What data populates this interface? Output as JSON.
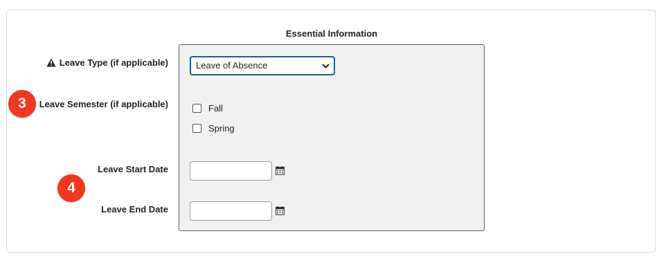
{
  "form": {
    "section_title": "Essential Information",
    "leave_type": {
      "label": "Leave Type (if applicable)",
      "value": "Leave of Absence",
      "icon": "warning-icon"
    },
    "leave_semester": {
      "label": "Leave Semester (if applicable)",
      "options": [
        {
          "label": "Fall",
          "checked": false
        },
        {
          "label": "Spring",
          "checked": false
        }
      ]
    },
    "leave_start_date": {
      "label": "Leave Start Date",
      "value": "",
      "icon": "calendar-icon"
    },
    "leave_end_date": {
      "label": "Leave End Date",
      "value": "",
      "icon": "calendar-icon"
    }
  },
  "annotations": [
    {
      "number": "3",
      "color": "#f3361f"
    },
    {
      "number": "4",
      "color": "#f3361f"
    }
  ],
  "colors": {
    "accent_border": "#1a5aa8",
    "panel_bg": "#f1f1f1",
    "badge": "#f3361f"
  }
}
